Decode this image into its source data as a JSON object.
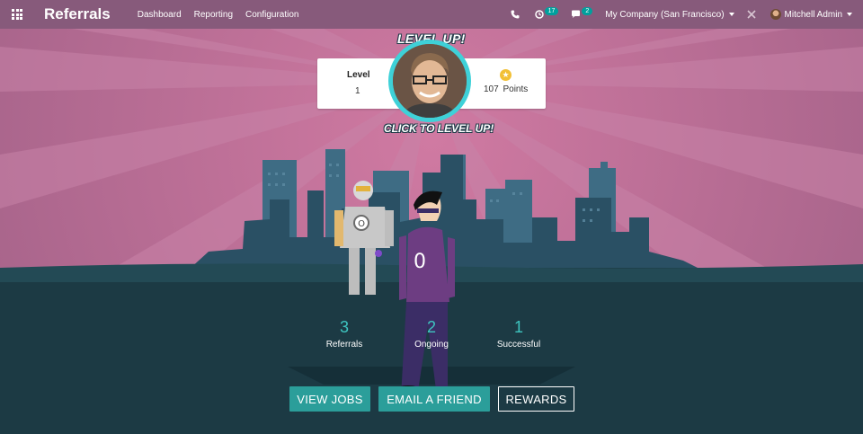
{
  "navbar": {
    "app_title": "Referrals",
    "menu": [
      "Dashboard",
      "Reporting",
      "Configuration"
    ],
    "activity_count": "17",
    "messages_count": "2",
    "company": "My Company (San Francisco)",
    "user": "Mitchell Admin"
  },
  "level": {
    "label": "Level",
    "value": "1",
    "points_value": "107",
    "points_unit": "Points",
    "level_up_text": "LEVEL UP!",
    "click_text": "CLICK TO LEVEL UP!"
  },
  "stats": [
    {
      "value": "3",
      "label": "Referrals"
    },
    {
      "value": "2",
      "label": "Ongoing"
    },
    {
      "value": "1",
      "label": "Successful"
    }
  ],
  "actions": {
    "view_jobs": "VIEW JOBS",
    "email_friend": "EMAIL A FRIEND",
    "rewards": "REWARDS"
  },
  "colors": {
    "navbar": "#875a7b",
    "accent": "#2b9e9a",
    "sky": "#b86d95",
    "ground": "#1c3a44"
  }
}
